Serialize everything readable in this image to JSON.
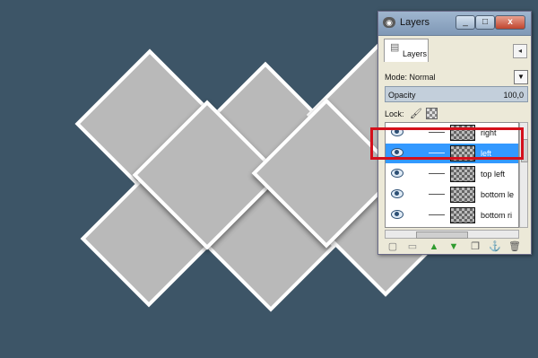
{
  "dialog": {
    "title": "Layers",
    "app_icon": "gimp-icon",
    "tab_label": "Layers",
    "mode_label": "Mode: Normal",
    "opacity_label": "Opacity",
    "opacity_value": "100,0",
    "lock_label": "Lock:",
    "close_glyph": "x",
    "min_glyph": "_",
    "max_glyph": "□"
  },
  "layers": [
    {
      "name": "right",
      "selected": false,
      "visible": true
    },
    {
      "name": "left",
      "selected": true,
      "visible": true
    },
    {
      "name": "top left",
      "selected": false,
      "visible": true
    },
    {
      "name": "bottom le",
      "selected": false,
      "visible": true
    },
    {
      "name": "bottom ri",
      "selected": false,
      "visible": true
    }
  ],
  "toolbar_icons": [
    "new-layer-icon",
    "new-group-icon",
    "raise-layer-icon",
    "lower-layer-icon",
    "duplicate-layer-icon",
    "anchor-layer-icon",
    "delete-layer-icon"
  ],
  "colors": {
    "background": "#3d5567",
    "tile_fill": "#b9b9b9",
    "tile_border": "#ffffff",
    "selection": "#3399ff",
    "highlight_box": "#d4101b"
  }
}
